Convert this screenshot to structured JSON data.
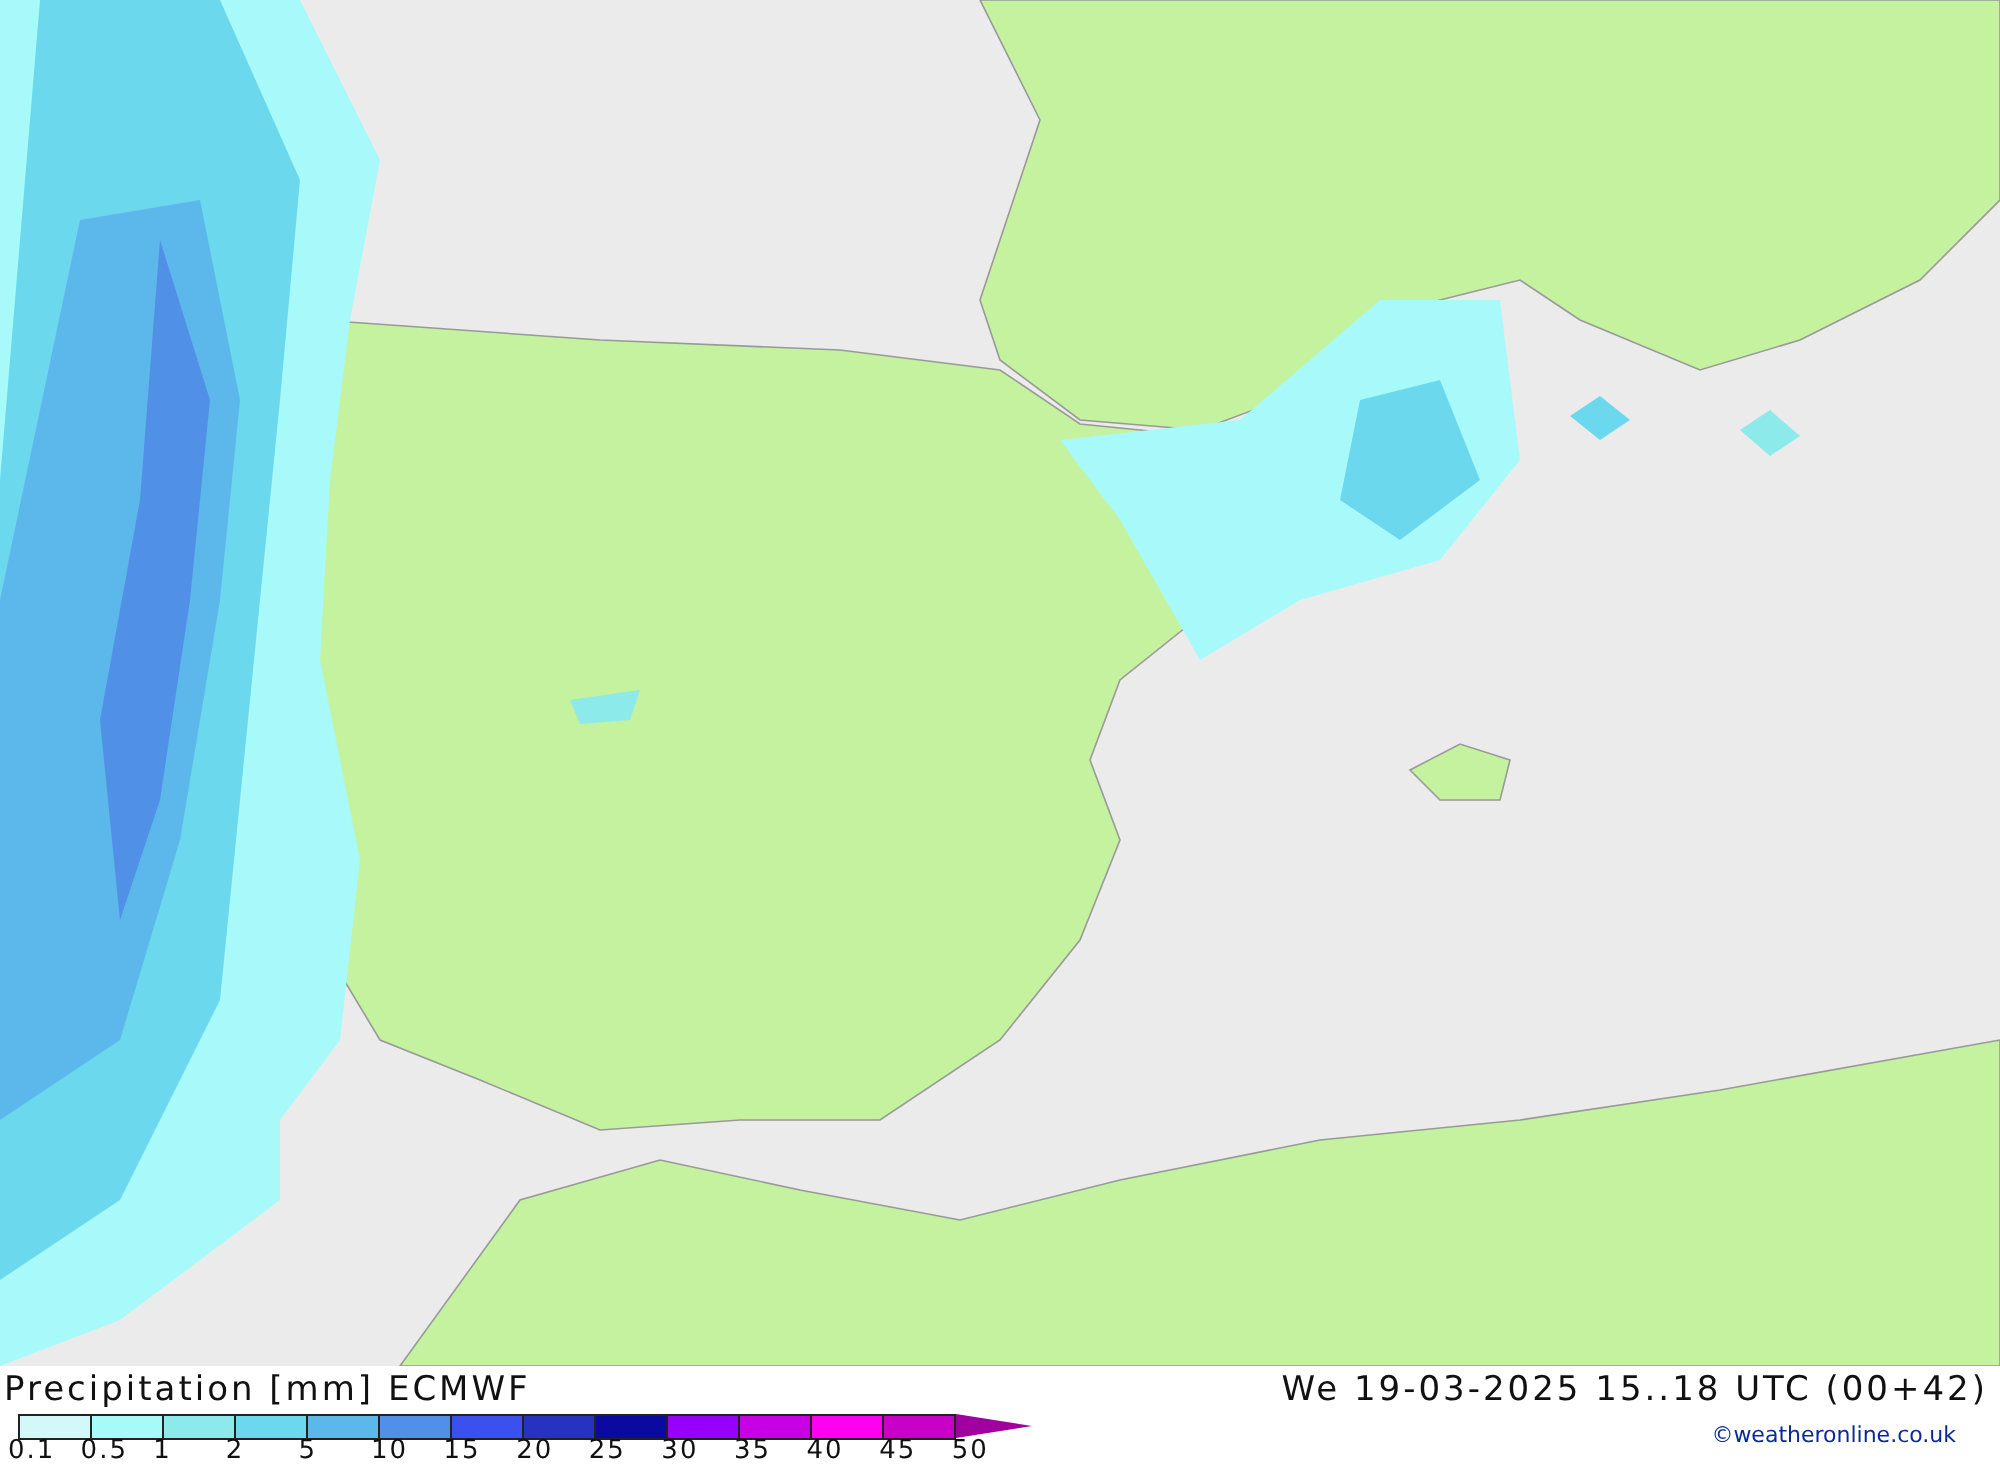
{
  "title": "Precipitation [mm] ECMWF",
  "valid_time": "We 19-03-2025 15..18 UTC (00+42)",
  "legend": {
    "bins": [
      {
        "color": "#d2f8f8"
      },
      {
        "color": "#a8fafa"
      },
      {
        "color": "#8ceaea"
      },
      {
        "color": "#6cd8ee"
      },
      {
        "color": "#5cb8ea"
      },
      {
        "color": "#5090e6"
      },
      {
        "color": "#3c50f0"
      },
      {
        "color": "#2832c0"
      },
      {
        "color": "#0a0aa0"
      },
      {
        "color": "#9600fa"
      },
      {
        "color": "#c800e6"
      },
      {
        "color": "#ff00f0"
      },
      {
        "color": "#c800c8"
      },
      {
        "color": "#a000a0",
        "kind": "arrow"
      }
    ],
    "labels": [
      "0.1",
      "0.5",
      "1",
      "2",
      "5",
      "10",
      "15",
      "20",
      "25",
      "30",
      "35",
      "40",
      "45",
      "50"
    ]
  },
  "credit": "©weatheronline.co.uk"
}
